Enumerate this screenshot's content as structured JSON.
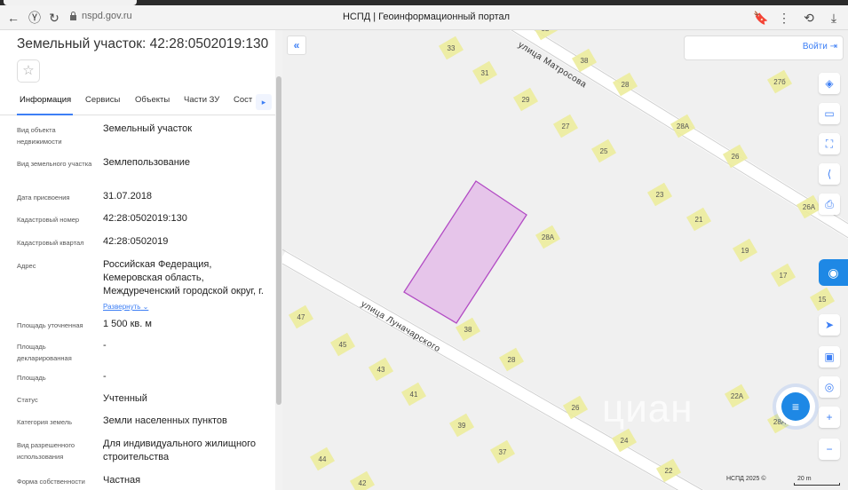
{
  "browser": {
    "back_icon": "arrow-left-icon",
    "reload_icon": "reload-icon",
    "address": "nspd.gov.ru",
    "page_title": "НСПД | Геоинформационный портал",
    "bookmark_icon": "bookmark-icon",
    "menu_icon": "more-icon",
    "download_icon": "download-icon"
  },
  "panel": {
    "title": "Земельный участок: 42:28:0502019:130",
    "star_icon": "star-icon",
    "tabs": [
      "Информация",
      "Сервисы",
      "Объекты",
      "Части ЗУ",
      "Сост"
    ],
    "rows": [
      {
        "label": "Вид объекта недвижимости",
        "value": "Земельный участок"
      },
      {
        "label": "Вид земельного участка",
        "value": "Землепользование"
      },
      {
        "label": "Дата присвоения",
        "value": "31.07.2018"
      },
      {
        "label": "Кадастровый номер",
        "value": "42:28:0502019:130"
      },
      {
        "label": "Кадастровый квартал",
        "value": "42:28:0502019"
      },
      {
        "label": "Адрес",
        "value": "Российская Федерация, Кемеровская область, Междуреченский городской округ, г.",
        "more": "Развернуть"
      },
      {
        "label": "Площадь уточненная",
        "value": "1 500 кв. м"
      },
      {
        "label": "Площадь декларированная",
        "value": "-"
      },
      {
        "label": "Площадь",
        "value": "-"
      },
      {
        "label": "Статус",
        "value": "Учтенный"
      },
      {
        "label": "Категория земель",
        "value": "Земли населенных пунктов"
      },
      {
        "label": "Вид разрешенного использования",
        "value": "Для индивидуального жилищного строительства"
      },
      {
        "label": "Форма собственности",
        "value": "Частная"
      }
    ]
  },
  "map": {
    "collapse_label": "«",
    "login_label": "Войти",
    "streets": [
      "улица Матросова",
      "улица Луначарского"
    ],
    "house_numbers": [
      "33",
      "32",
      "31",
      "38",
      "28",
      "29",
      "27",
      "25",
      "28А",
      "27б",
      "26",
      "23",
      "21",
      "28А",
      "19",
      "17",
      "15",
      "26А",
      "47",
      "38",
      "45",
      "43",
      "28",
      "41",
      "39",
      "37",
      "44",
      "42",
      "26",
      "24",
      "22А",
      "28А",
      "22"
    ],
    "copyright": "НСПД 2025 ©",
    "scale": "20 m",
    "watermark": "циан",
    "tools": [
      "layers-icon",
      "ruler-icon",
      "area-icon",
      "share-icon",
      "print-icon",
      "navigation-icon",
      "fullscreen-icon",
      "location-icon",
      "zoom-in-icon",
      "zoom-out-icon"
    ],
    "parcel_color": "#e6c5ea",
    "accent": "#3d7ff5"
  }
}
